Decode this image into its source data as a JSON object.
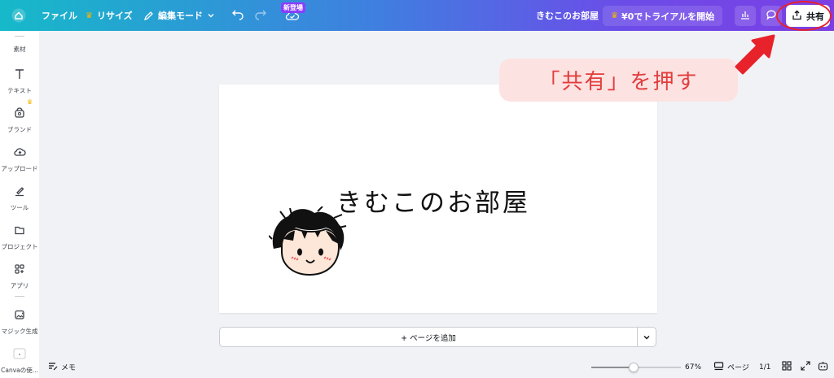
{
  "topbar": {
    "file_label": "ファイル",
    "resize_label": "リサイズ",
    "edit_mode_label": "編集モード",
    "new_badge": "新登場",
    "doc_title": "きむこのお部屋",
    "trial_label": "¥0でトライアルを開始",
    "share_label": "共有"
  },
  "sidebar": {
    "items": [
      {
        "label": "素材"
      },
      {
        "label": "テキスト"
      },
      {
        "label": "ブランド"
      },
      {
        "label": "アップロード"
      },
      {
        "label": "ツール"
      },
      {
        "label": "プロジェクト"
      },
      {
        "label": "アプリ"
      },
      {
        "label": "マジック生成"
      },
      {
        "label": "Canvaの使..."
      }
    ]
  },
  "canvas": {
    "heading": "きむこのお部屋"
  },
  "add_page_label": "+ ページを追加",
  "callout_text": "「共有」を押す",
  "bottombar": {
    "notes_label": "メモ",
    "zoom": "67%",
    "zoom_fraction": 0.47,
    "pages_label": "ページ",
    "page_count": "1/1"
  },
  "colors": {
    "accent_red": "#e8222b",
    "callout_bg": "#fde2e2",
    "crown": "#f7b500",
    "badge": "#8b3dff"
  }
}
